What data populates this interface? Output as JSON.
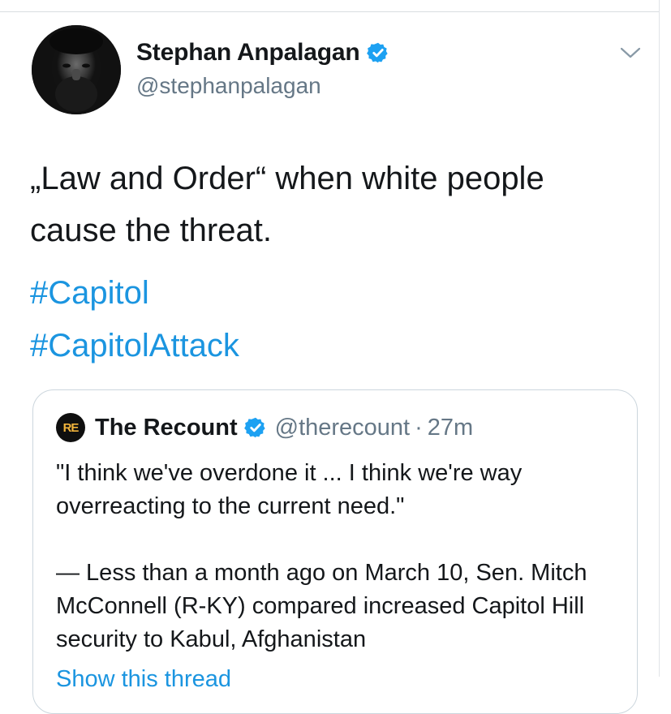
{
  "tweet": {
    "author_name": "Stephan Anpalagan",
    "author_handle": "@stephanpalagan",
    "text": "„Law and Order“ when white people cause the threat.",
    "hashtags": [
      "#Capitol",
      "#CapitolAttack"
    ]
  },
  "quoted_tweet": {
    "avatar_text": "RE",
    "author_name": "The Recount",
    "author_handle": "@therecount",
    "separator": "·",
    "time": "27m",
    "paragraphs": [
      "\"I think we've overdone it ... I think we're way overreacting to the current need.\"",
      "— Less than a month ago on March 10, Sen. Mitch McConnell (R-KY) compared increased Capitol Hill security to Kabul, Afghanistan"
    ],
    "show_thread": "Show this thread"
  },
  "icons": {
    "verified": "verified-badge-icon",
    "menu": "chevron-down-icon"
  },
  "colors": {
    "link": "#1b95e0",
    "verified": "#1da1f2",
    "secondary_text": "#657786",
    "border": "#ccd6dd",
    "recount_accent": "#f3b53c"
  }
}
